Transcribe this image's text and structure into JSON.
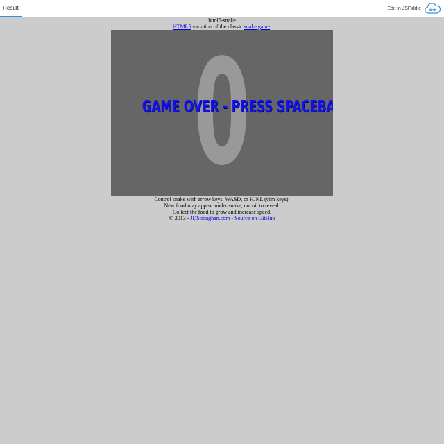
{
  "topbar": {
    "tab_label": "Result",
    "edit_label": "Edit in JSFiddle",
    "logo_icon": "jsfiddle-cloud-icon",
    "accent_color": "#3790d6"
  },
  "page": {
    "title": "html5-snake",
    "subtitle": {
      "link1": "HTML5",
      "text1": " variation of the classic ",
      "link2": "snake game",
      "text2": "."
    }
  },
  "game": {
    "score": "0",
    "message": "GAME OVER - PRESS SPACEBAR",
    "board_color": "#666666",
    "score_color": "#999999",
    "message_color": "#1212e8"
  },
  "instructions": {
    "line1": "Control snake with arrow keys, WASD, or HJKL (vim keys).",
    "line2": "New food may appear under snake, uncoil to reveal.",
    "line3": "Collect the food to grow and increase speed.",
    "line4": {
      "prefix": "© 2013 - ",
      "link1": "JDStraughan.com",
      "sep": " - ",
      "link2": "Source on GitHub"
    }
  }
}
